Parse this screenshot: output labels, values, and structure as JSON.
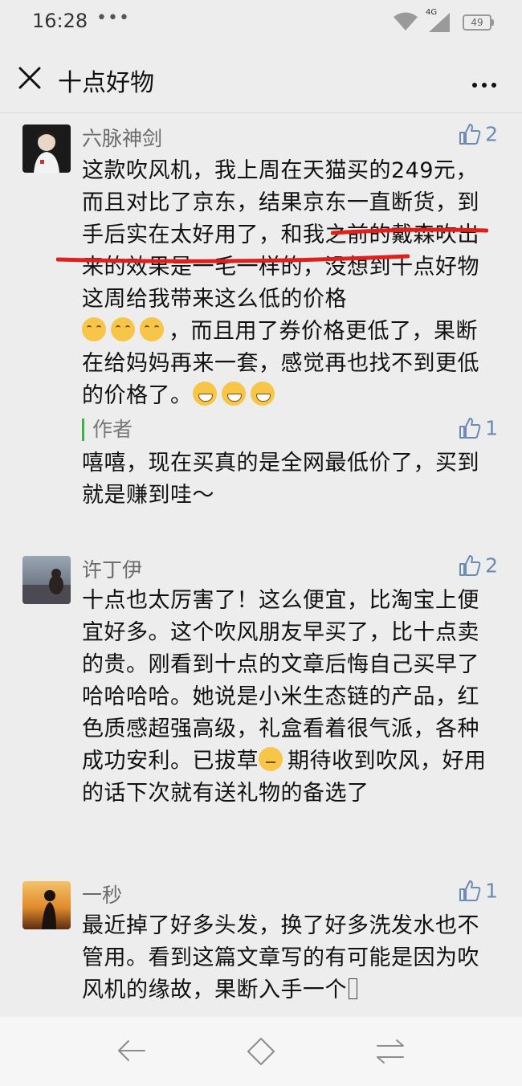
{
  "status_bar": {
    "time": "16:28",
    "dots": "•••",
    "network": "4G",
    "battery": "49"
  },
  "nav": {
    "title": "十点好物"
  },
  "comments": [
    {
      "nickname": "六脉神剑",
      "likes": "2",
      "text_a": "这款吹风机，我上周在天猫买的249元，而且对比了京东，结果京东一直断货，到手后实在太好用了，和我之前的戴森吹出来的效果是一毛一样的，没想到十点好物这周给我带来这么低的价格",
      "text_b": "，而且用了券价格更低了，果断在给妈妈再来一套，感觉再也找不到更低的价格了。",
      "reply": {
        "label": "作者",
        "likes": "1",
        "text": "嘻嘻，现在买真的是全网最低价了，买到就是赚到哇～"
      }
    },
    {
      "nickname": "许丁伊",
      "likes": "2",
      "text_a": "十点也太厉害了！这么便宜，比淘宝上便宜好多。这个吹风朋友早买了，比十点卖的贵。刚看到十点的文章后悔自己买早了哈哈哈哈。她说是小米生态链的产品，红色质感超强高级，礼盒看着很气派，各种成功安利。已拔草",
      "text_b": "期待收到吹风，好用的话下次就有送礼物的备选了"
    },
    {
      "nickname": "一秒",
      "likes": "1",
      "text_a": "最近掉了好多头发，换了好多洗发水也不管用。看到这篇文章写的有可能是因为吹风机的缘故，果断入手一个",
      "text_b": ""
    }
  ],
  "colors": {
    "accent_green": "#3cb34a",
    "like_blue": "#6b8bb5",
    "annotation_red": "#e0201c"
  }
}
